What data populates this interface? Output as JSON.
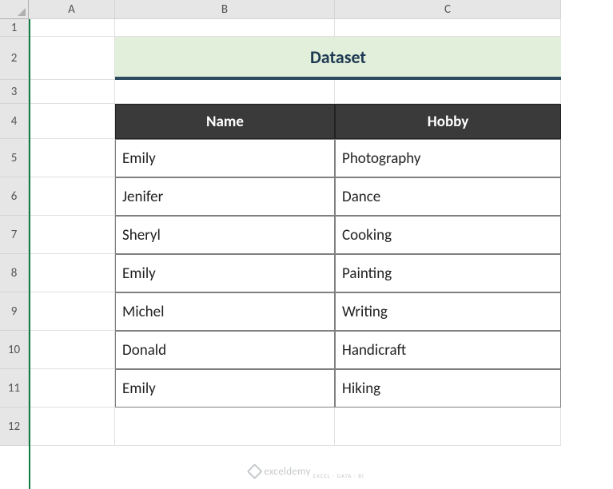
{
  "columns": [
    "A",
    "B",
    "C"
  ],
  "rows": [
    "1",
    "2",
    "3",
    "4",
    "5",
    "6",
    "7",
    "8",
    "9",
    "10",
    "11",
    "12"
  ],
  "banner": {
    "title": "Dataset"
  },
  "table": {
    "headers": {
      "name": "Name",
      "hobby": "Hobby"
    },
    "rows": [
      {
        "name": "Emily",
        "hobby": "Photography"
      },
      {
        "name": "Jenifer",
        "hobby": "Dance"
      },
      {
        "name": "Sheryl",
        "hobby": "Cooking"
      },
      {
        "name": "Emily",
        "hobby": "Painting"
      },
      {
        "name": "Michel",
        "hobby": "Writing"
      },
      {
        "name": "Donald",
        "hobby": "Handicraft"
      },
      {
        "name": "Emily",
        "hobby": "Hiking"
      }
    ]
  },
  "watermark": {
    "brand": "exceldemy",
    "tagline": "EXCEL · DATA · BI"
  },
  "layout": {
    "col_header_h": 24,
    "row_header_w": 36,
    "col_widths": {
      "A": 108,
      "B": 275,
      "C": 283
    },
    "row_heights": {
      "1": 22,
      "2": 54,
      "3": 30,
      "4": 44,
      "5": 48,
      "6": 48,
      "7": 48,
      "8": 48,
      "9": 48,
      "10": 48,
      "11": 48,
      "12": 48
    }
  }
}
